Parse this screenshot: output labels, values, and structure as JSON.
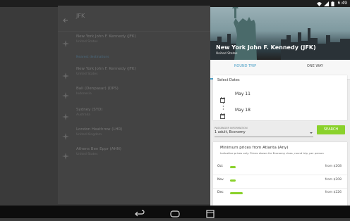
{
  "status_bar": {
    "time": "6:49"
  },
  "search": {
    "query": "JFK"
  },
  "results": [
    {
      "name": "New York John F. Kennedy (JFK)",
      "country": "United States"
    },
    {
      "name": "New York John F. Kennedy (JFK)",
      "country": "United States"
    },
    {
      "name": "Bali (Denpasar) (DPS)",
      "country": "Indonesia"
    },
    {
      "name": "Sydney (SYD)",
      "country": "Australia"
    },
    {
      "name": "London Heathrow (LHR)",
      "country": "United Kingdom"
    },
    {
      "name": "Athens Ben Eppr (AHN)",
      "country": "United States"
    }
  ],
  "nearby_label": "Nearest destinations",
  "panel": {
    "title": "New York John F. Kennedy (JFK)",
    "subtitle": "United States",
    "tabs": {
      "round_trip": "ROUND TRIP",
      "one_way": "ONE WAY"
    },
    "select_dates_label": "Select Dates",
    "depart_date": "May 11",
    "return_date": "May 18",
    "passenger_label": "PASSENGER INFORMATION",
    "passenger_value": "1 adult, Economy",
    "search_label": "SEARCH",
    "prices_title": "Minimum prices from Atlanta (Any)",
    "prices_sub": "Indicative prices only. Prices shown for Economy class, round trip, per person",
    "prices": [
      {
        "month": "Oct",
        "price": "from $208",
        "level": 0.2
      },
      {
        "month": "Nov",
        "price": "from $208",
        "level": 0.2
      },
      {
        "month": "Dec",
        "price": "from $226",
        "level": 0.45
      }
    ]
  },
  "colors": {
    "accent": "#4ea1c8",
    "green": "#8ad12b"
  }
}
